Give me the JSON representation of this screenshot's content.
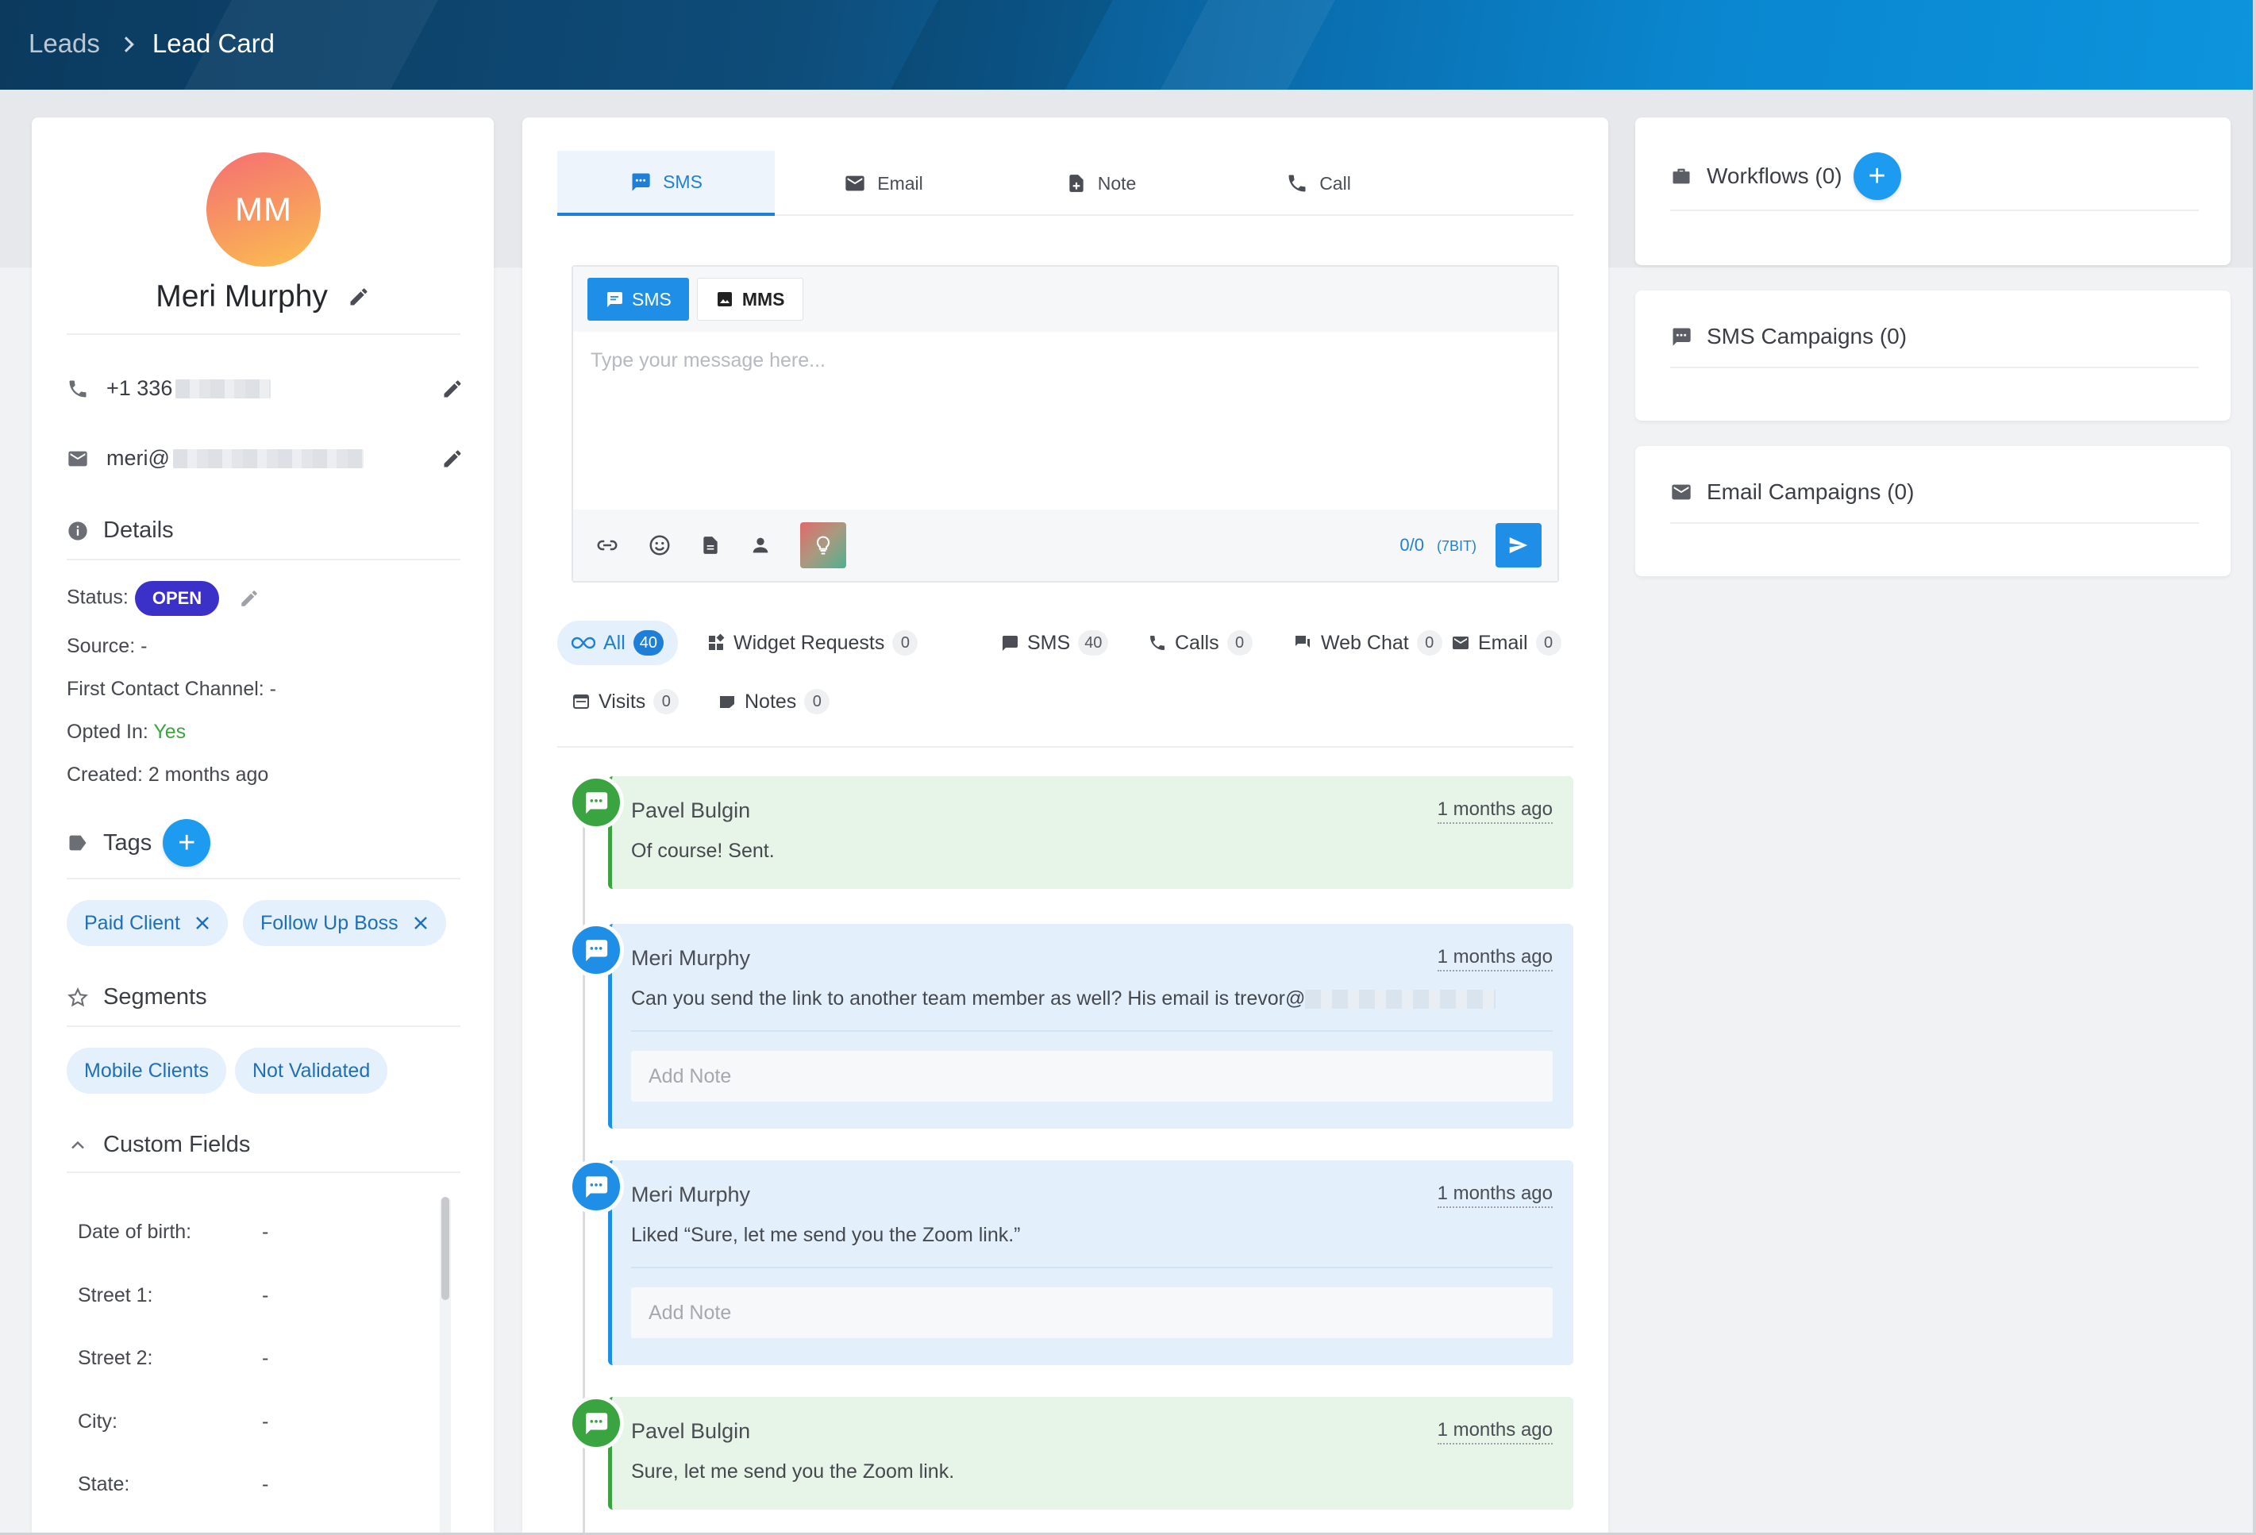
{
  "breadcrumb": {
    "parent": "Leads",
    "current": "Lead Card"
  },
  "lead": {
    "initials": "MM",
    "name": "Meri Murphy",
    "phone_prefix": "+1 336",
    "email_prefix": "meri@"
  },
  "details": {
    "title": "Details",
    "status_label": "Status:",
    "status_value": "OPEN",
    "source": "Source: -",
    "first_contact": "First Contact Channel: -",
    "opted_in_label": "Opted In:",
    "opted_in_value": "Yes",
    "created": "Created: 2 months ago"
  },
  "tags": {
    "title": "Tags",
    "items": [
      "Paid Client",
      "Follow Up Boss"
    ]
  },
  "segments": {
    "title": "Segments",
    "items": [
      "Mobile Clients",
      "Not Validated"
    ]
  },
  "custom_fields": {
    "title": "Custom Fields",
    "rows": [
      {
        "label": "Date of birth:",
        "value": "-"
      },
      {
        "label": "Street 1:",
        "value": "-"
      },
      {
        "label": "Street 2:",
        "value": "-"
      },
      {
        "label": "City:",
        "value": "-"
      },
      {
        "label": "State:",
        "value": "-"
      }
    ]
  },
  "tabs": [
    "SMS",
    "Email",
    "Note",
    "Call"
  ],
  "composer": {
    "sms_tab": "SMS",
    "mms_tab": "MMS",
    "placeholder": "Type your message here...",
    "counter": "0/0",
    "encoding": "(7BIT)"
  },
  "filters": [
    {
      "label": "All",
      "count": "40"
    },
    {
      "label": "Widget Requests",
      "count": "0"
    },
    {
      "label": "SMS",
      "count": "40"
    },
    {
      "label": "Calls",
      "count": "0"
    },
    {
      "label": "Web Chat",
      "count": "0"
    },
    {
      "label": "Email",
      "count": "0"
    },
    {
      "label": "Visits",
      "count": "0"
    },
    {
      "label": "Notes",
      "count": "0"
    }
  ],
  "timeline": [
    {
      "author": "Pavel Bulgin",
      "time": "1 months ago",
      "text": "Of course! Sent.",
      "color": "green"
    },
    {
      "author": "Meri Murphy",
      "time": "1 months ago",
      "text": "Can you send the link to another team member as well? His email is trevor@",
      "note_placeholder": "Add Note",
      "color": "blue"
    },
    {
      "author": "Meri Murphy",
      "time": "1 months ago",
      "text": "Liked “Sure, let me send you the Zoom link.”",
      "note_placeholder": "Add Note",
      "color": "blue"
    },
    {
      "author": "Pavel Bulgin",
      "time": "1 months ago",
      "text": "Sure, let me send you the Zoom link.",
      "color": "green"
    }
  ],
  "right": {
    "workflows": "Workflows (0)",
    "sms_campaigns": "SMS Campaigns (0)",
    "email_campaigns": "Email Campaigns (0)"
  },
  "colors": {
    "accent": "#1e8ee6",
    "status_open": "#3b31c9",
    "sent": "#3aa540"
  }
}
